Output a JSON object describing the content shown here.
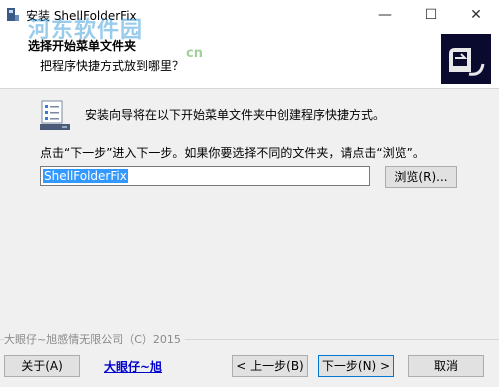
{
  "window": {
    "title": "安装 ShellFolderFix",
    "minimize_glyph": "—",
    "maximize_glyph": "☐",
    "close_glyph": "✕"
  },
  "watermark": {
    "text": "河东软件园",
    "url": "cn"
  },
  "header": {
    "title": "选择开始菜单文件夹",
    "subtitle": "把程序快捷方式放到哪里？"
  },
  "body": {
    "intro": "安装向导将在以下开始菜单文件夹中创建程序快捷方式。",
    "instruction": "点击“下一步”进入下一步。如果你要选择不同的文件夹，请点击“浏览”。",
    "folder_value": "ShellFolderFix",
    "browse_label": "浏览(R)..."
  },
  "footer": {
    "copyright": "大眼仔~旭感情无限公司（C）2015",
    "about_label": "关于(A)",
    "link_text": "大眼仔~旭",
    "back_label": "< 上一步(B)",
    "next_label": "下一步(N) >",
    "cancel_label": "取消"
  },
  "colors": {
    "selection": "#3399ff",
    "link": "#0000cc",
    "focus_border": "#0078d7",
    "logo_bg": "#0a0a2e"
  }
}
